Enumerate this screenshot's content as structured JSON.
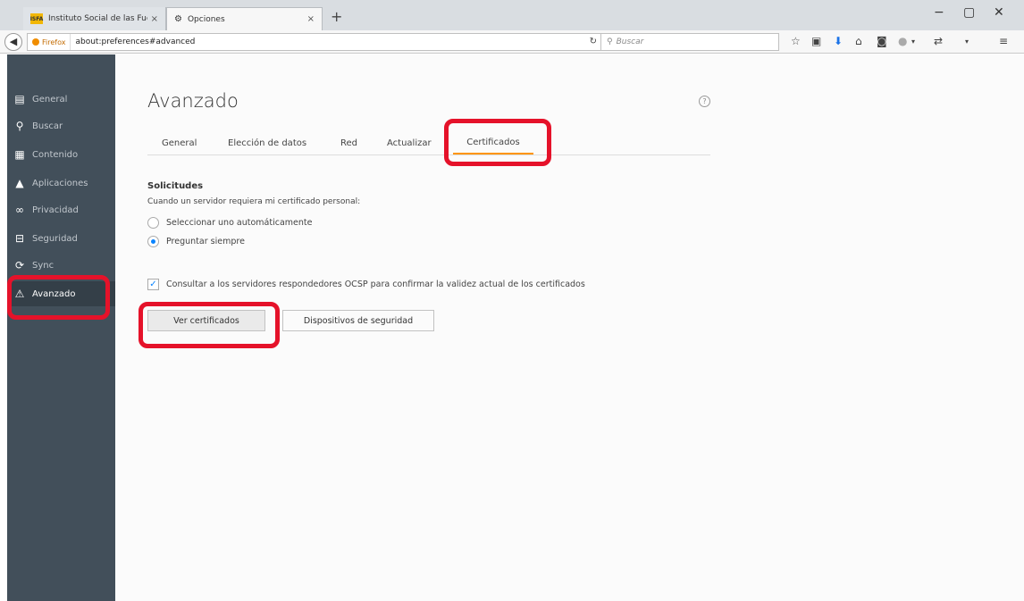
{
  "browser": {
    "tabs": [
      {
        "title": "Instituto Social de las Fuer...",
        "favicon": "ISFA"
      },
      {
        "title": "Opciones",
        "favicon": "gear"
      }
    ],
    "tab_close": "×",
    "new_tab": "+",
    "window_controls": {
      "minimize": "−",
      "maximize": "▢",
      "close": "✕"
    },
    "identity_label": "Firefox",
    "url": "about:preferences#advanced",
    "search_placeholder": "Buscar"
  },
  "sidebar": {
    "items": [
      {
        "label": "General",
        "icon": "general-icon"
      },
      {
        "label": "Buscar",
        "icon": "search-icon"
      },
      {
        "label": "Contenido",
        "icon": "content-icon"
      },
      {
        "label": "Aplicaciones",
        "icon": "applications-icon"
      },
      {
        "label": "Privacidad",
        "icon": "privacy-mask-icon"
      },
      {
        "label": "Seguridad",
        "icon": "lock-icon"
      },
      {
        "label": "Sync",
        "icon": "sync-icon"
      },
      {
        "label": "Avanzado",
        "icon": "wizard-hat-icon"
      }
    ],
    "selected": "Avanzado"
  },
  "main": {
    "title": "Avanzado",
    "tabs": [
      {
        "label": "General"
      },
      {
        "label": "Elección de datos"
      },
      {
        "label": "Red"
      },
      {
        "label": "Actualizar"
      },
      {
        "label": "Certificados"
      }
    ],
    "selected_tab": "Certificados",
    "section_title": "Solicitudes",
    "description": "Cuando un servidor requiera mi certificado personal:",
    "radio_options": [
      {
        "label": "Seleccionar uno automáticamente",
        "checked": false
      },
      {
        "label": "Preguntar siempre",
        "checked": true
      }
    ],
    "ocsp_checkbox": {
      "label": "Consultar a los servidores respondedores OCSP para confirmar la validez actual de los certificados",
      "checked": true
    },
    "buttons": {
      "view_certificates": "Ver certificados",
      "security_devices": "Dispositivos de seguridad"
    }
  },
  "colors": {
    "sidebar_bg": "#424f5a",
    "accent_orange": "#ff9500",
    "highlight_red": "#e5122a",
    "radio_blue": "#0a84ff"
  }
}
